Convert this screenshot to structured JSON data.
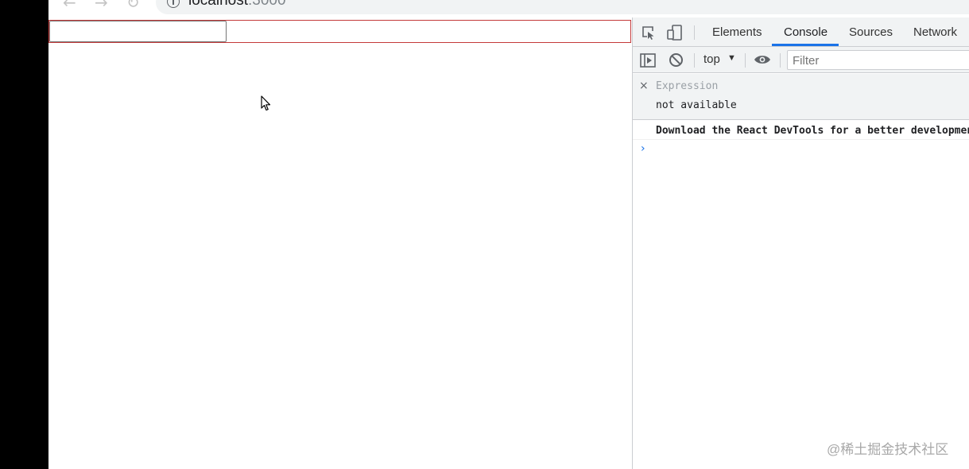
{
  "browser": {
    "url_host": "localhost",
    "url_port": ":3000"
  },
  "devtools": {
    "tabs": [
      "Elements",
      "Console",
      "Sources",
      "Network"
    ],
    "active_tab": "Console",
    "context": "top",
    "filter_placeholder": "Filter",
    "expression_label": "Expression",
    "expression_value": "not available",
    "log_message": "Download the React DevTools for a better development experience"
  },
  "watermark": "@稀土掘金技术社区",
  "colors": {
    "accent": "#1a73e8",
    "highlight_border": "#c43a3a"
  }
}
